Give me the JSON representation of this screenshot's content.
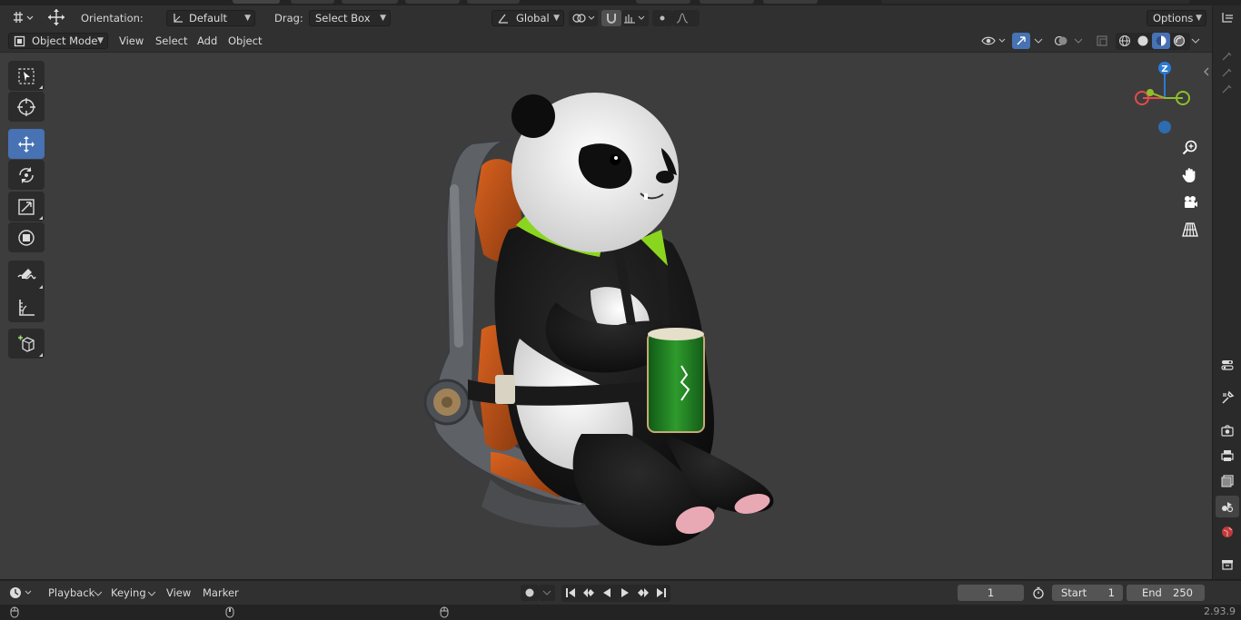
{
  "tool_header": {
    "orientation_label": "Orientation:",
    "orientation_value": "Default",
    "drag_label": "Drag:",
    "drag_value": "Select Box",
    "transform_orientation": "Global",
    "options_label": "Options"
  },
  "viewport_header": {
    "mode": "Object Mode",
    "menus": [
      "View",
      "Select",
      "Add",
      "Object"
    ]
  },
  "toolbar": {
    "tools": [
      {
        "name": "select-box-tool",
        "icon": "select-box-icon",
        "active": false
      },
      {
        "name": "cursor-tool",
        "icon": "cursor-icon",
        "active": false
      },
      {
        "name": "move-tool",
        "icon": "move-icon",
        "active": true
      },
      {
        "name": "rotate-tool",
        "icon": "rotate-icon",
        "active": false
      },
      {
        "name": "scale-tool",
        "icon": "scale-icon",
        "active": false
      },
      {
        "name": "transform-tool",
        "icon": "transform-icon",
        "active": false
      },
      {
        "name": "annotate-tool",
        "icon": "annotate-icon",
        "active": false
      },
      {
        "name": "measure-tool",
        "icon": "measure-icon",
        "active": false
      },
      {
        "name": "add-cube-tool",
        "icon": "add-cube-icon",
        "active": false
      }
    ]
  },
  "gizmo": {
    "z_label": "Z",
    "colors": {
      "x": "#e64a4a",
      "y": "#8fbf2a",
      "z": "#2b7bd6"
    }
  },
  "timeline": {
    "menus": [
      "Playback",
      "Keying",
      "View",
      "Marker"
    ],
    "current_frame": "1",
    "start_label": "Start",
    "start_value": "1",
    "end_label": "End",
    "end_value": "250"
  },
  "status_bar": {
    "version": "2.93.9"
  },
  "colors": {
    "accent": "#4772b3",
    "viewport_bg": "#3d3d3d",
    "header_bg": "#303030"
  }
}
